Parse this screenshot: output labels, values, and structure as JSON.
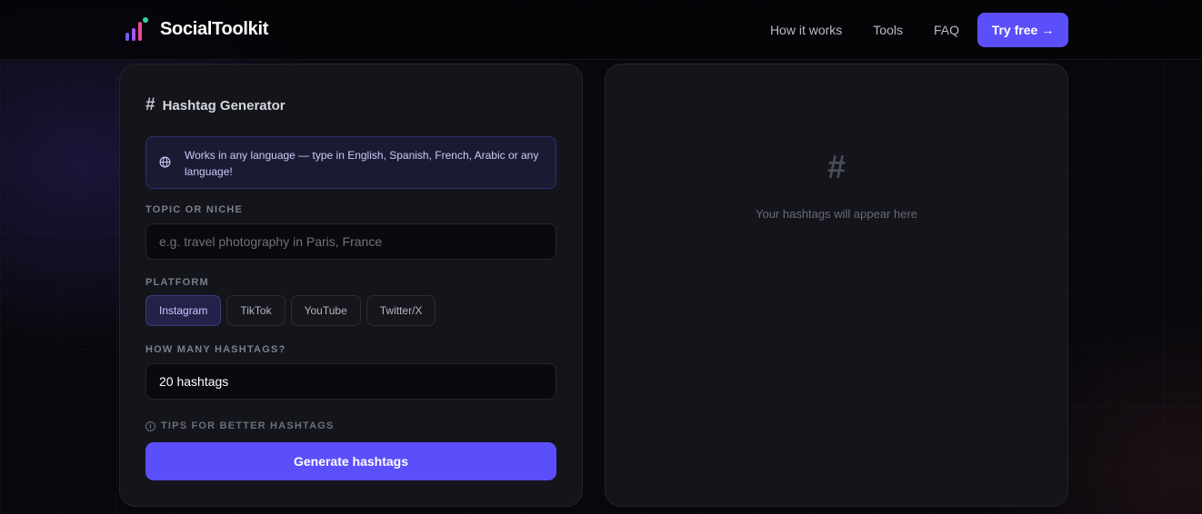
{
  "header": {
    "brand_name": "SocialToolkit",
    "nav": [
      {
        "label": "How it works"
      },
      {
        "label": "Tools"
      },
      {
        "label": "FAQ"
      }
    ],
    "cta_label": "Try free",
    "cta_icon": "arrow-right-icon"
  },
  "generator": {
    "title_icon": "hash-icon",
    "title": "Hashtag Generator",
    "info_icon": "globe-icon",
    "info_text": "Works in any language — type in English, Spanish, French, Arabic or any language!",
    "topic_label": "TOPIC OR NICHE",
    "topic_placeholder": "e.g. travel photography in Paris, France",
    "topic_value": "",
    "platform_label": "PLATFORM",
    "platforms": [
      {
        "label": "Instagram",
        "selected": true
      },
      {
        "label": "TikTok",
        "selected": false
      },
      {
        "label": "YouTube",
        "selected": false
      },
      {
        "label": "Twitter/X",
        "selected": false
      }
    ],
    "count_label": "HOW MANY HASHTAGS?",
    "count_value": "20 hashtags",
    "tips_label": "TIPS FOR BETTER HASHTAGS",
    "generate_label": "Generate hashtags"
  },
  "results": {
    "placeholder_icon": "#",
    "placeholder_text": "Your hashtags will appear here"
  },
  "colors": {
    "accent": "#5b4ffb",
    "background": "#08080c",
    "card": "#14141b"
  }
}
